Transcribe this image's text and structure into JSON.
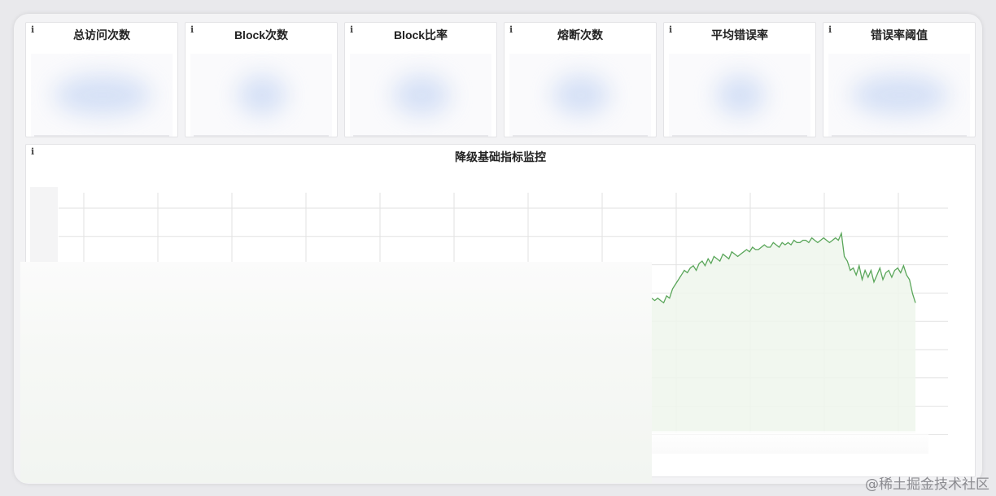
{
  "watermark": "@稀土掘金技术社区",
  "info_glyph": "i",
  "stat_panels": [
    {
      "title": "总访问次数"
    },
    {
      "title": "Block次数"
    },
    {
      "title": "Block比率"
    },
    {
      "title": "熔断次数"
    },
    {
      "title": "平均错误率"
    },
    {
      "title": "错误率阈值"
    }
  ],
  "main_panel": {
    "title": "降级基础指标监控"
  },
  "colors": {
    "series_line": "#5aa65a",
    "series_fill": "#eef6ec",
    "grid": "#e2e2e2",
    "blur_blob": "#c9d8f4"
  },
  "chart_data": {
    "type": "area",
    "title": "降级基础指标监控",
    "xlabel": "",
    "ylabel": "",
    "grid": true,
    "x_tick_count": 12,
    "y_tick_count": 9,
    "ylim": [
      0,
      100
    ],
    "series": [
      {
        "values": [
          58,
          57,
          58,
          57,
          56,
          59,
          58,
          62,
          64,
          66,
          68,
          70,
          69,
          71,
          72,
          70,
          73,
          74,
          72,
          75,
          73,
          76,
          75,
          74,
          77,
          76,
          75,
          78,
          77,
          76,
          77,
          78,
          79,
          78,
          80,
          79,
          79,
          80,
          81,
          80,
          80,
          82,
          81,
          80,
          82,
          81,
          82,
          81,
          83,
          82,
          82,
          83,
          83,
          82,
          84,
          83,
          82,
          83,
          84,
          83,
          82,
          83,
          84,
          83,
          86,
          76,
          74,
          70,
          71,
          68,
          72,
          66,
          70,
          67,
          70,
          65,
          68,
          71,
          66,
          69,
          70,
          67,
          70,
          71,
          69,
          72,
          68,
          66,
          60,
          56
        ]
      }
    ]
  }
}
